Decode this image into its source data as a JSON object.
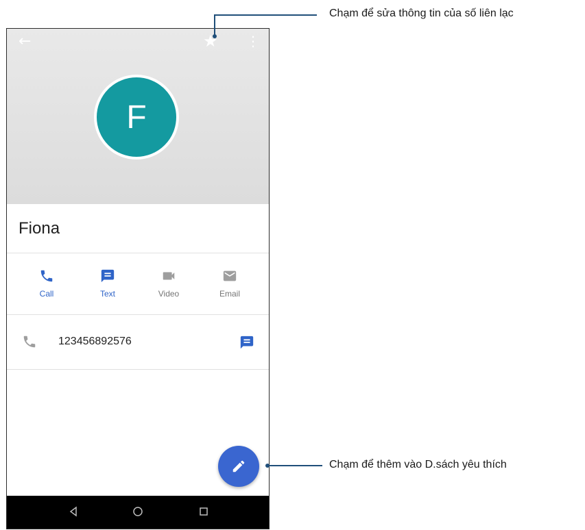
{
  "contact": {
    "initial": "F",
    "name": "Fiona",
    "avatar_color": "#149aa0",
    "phone_number": "123456892576"
  },
  "topbar": {
    "back_icon": "arrow-left-icon",
    "favorite_icon": "star-icon",
    "menu_icon": "more-vertical-icon"
  },
  "actions": [
    {
      "label": "Call",
      "icon": "phone-icon",
      "color": "#2f64c8"
    },
    {
      "label": "Text",
      "icon": "message-icon",
      "color": "#2f64c8"
    },
    {
      "label": "Video",
      "icon": "videocam-icon",
      "color": "#757575"
    },
    {
      "label": "Email",
      "icon": "envelope-icon",
      "color": "#757575"
    }
  ],
  "fab": {
    "icon": "pencil-icon",
    "color": "#3a66d0"
  },
  "navbar": {
    "icons": [
      "back-triangle-icon",
      "home-circle-icon",
      "recents-square-icon"
    ]
  },
  "callouts": {
    "top": "Chạm để sửa thông tin của số liên lạc",
    "bottom": "Chạm để thêm vào D.sách yêu thích"
  }
}
